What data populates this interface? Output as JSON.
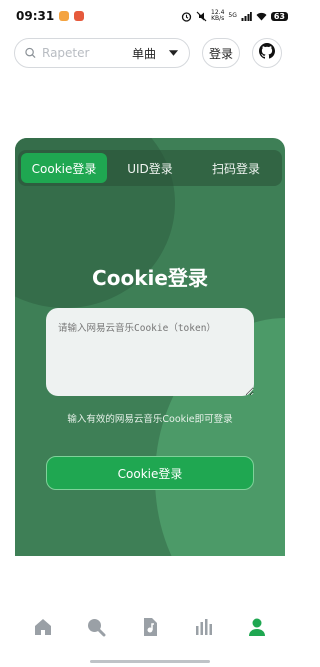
{
  "status_bar": {
    "time": "09:31",
    "network_speed": "12.4\nKB/s",
    "network_type": "5G",
    "battery": "63"
  },
  "search": {
    "placeholder": "Rapeter",
    "mode_label": "单曲"
  },
  "header": {
    "login_label": "登录"
  },
  "login_card": {
    "tabs": [
      {
        "label": "Cookie登录",
        "active": true
      },
      {
        "label": "UID登录",
        "active": false
      },
      {
        "label": "扫码登录",
        "active": false
      }
    ],
    "title": "Cookie登录",
    "input_placeholder": "请输入网易云音乐Cookie（token）",
    "hint": "输入有效的网易云音乐Cookie即可登录",
    "submit_label": "Cookie登录"
  },
  "bottom_nav": [
    {
      "icon": "home-icon",
      "active": false
    },
    {
      "icon": "search-icon",
      "active": false
    },
    {
      "icon": "playlist-icon",
      "active": false
    },
    {
      "icon": "chart-icon",
      "active": false
    },
    {
      "icon": "user-icon",
      "active": true
    }
  ],
  "colors": {
    "accent": "#1fa751",
    "card_bg": "#3e7f56",
    "nav_inactive": "#9aa0a6",
    "nav_active": "#1fa751"
  }
}
